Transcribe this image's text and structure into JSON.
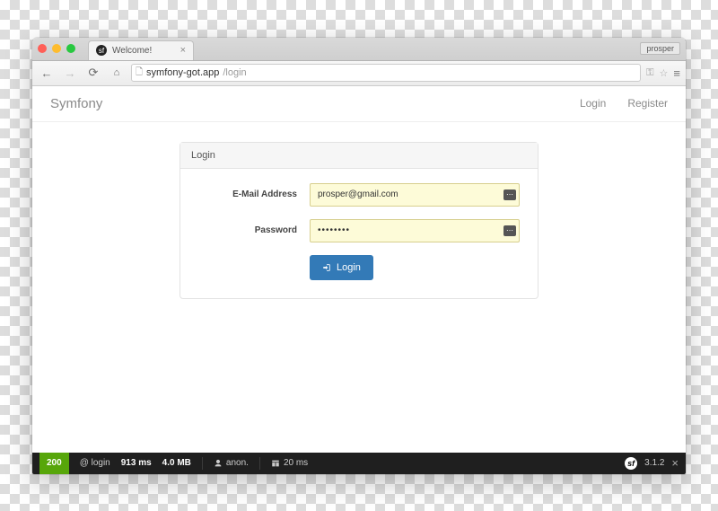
{
  "browser": {
    "tab_title": "Welcome!",
    "user_button": "prosper",
    "url_host": "symfony-got.app",
    "url_path": "/login"
  },
  "navbar": {
    "brand": "Symfony",
    "login_link": "Login",
    "register_link": "Register"
  },
  "panel": {
    "heading": "Login"
  },
  "form": {
    "email_label": "E-Mail Address",
    "email_value": "prosper@gmail.com",
    "password_label": "Password",
    "password_value": "••••••••",
    "submit_label": "Login"
  },
  "debug": {
    "status": "200",
    "route": "@ login",
    "time": "913 ms",
    "memory": "4.0 MB",
    "user": "anon.",
    "render_time": "20 ms",
    "version": "3.1.2"
  }
}
